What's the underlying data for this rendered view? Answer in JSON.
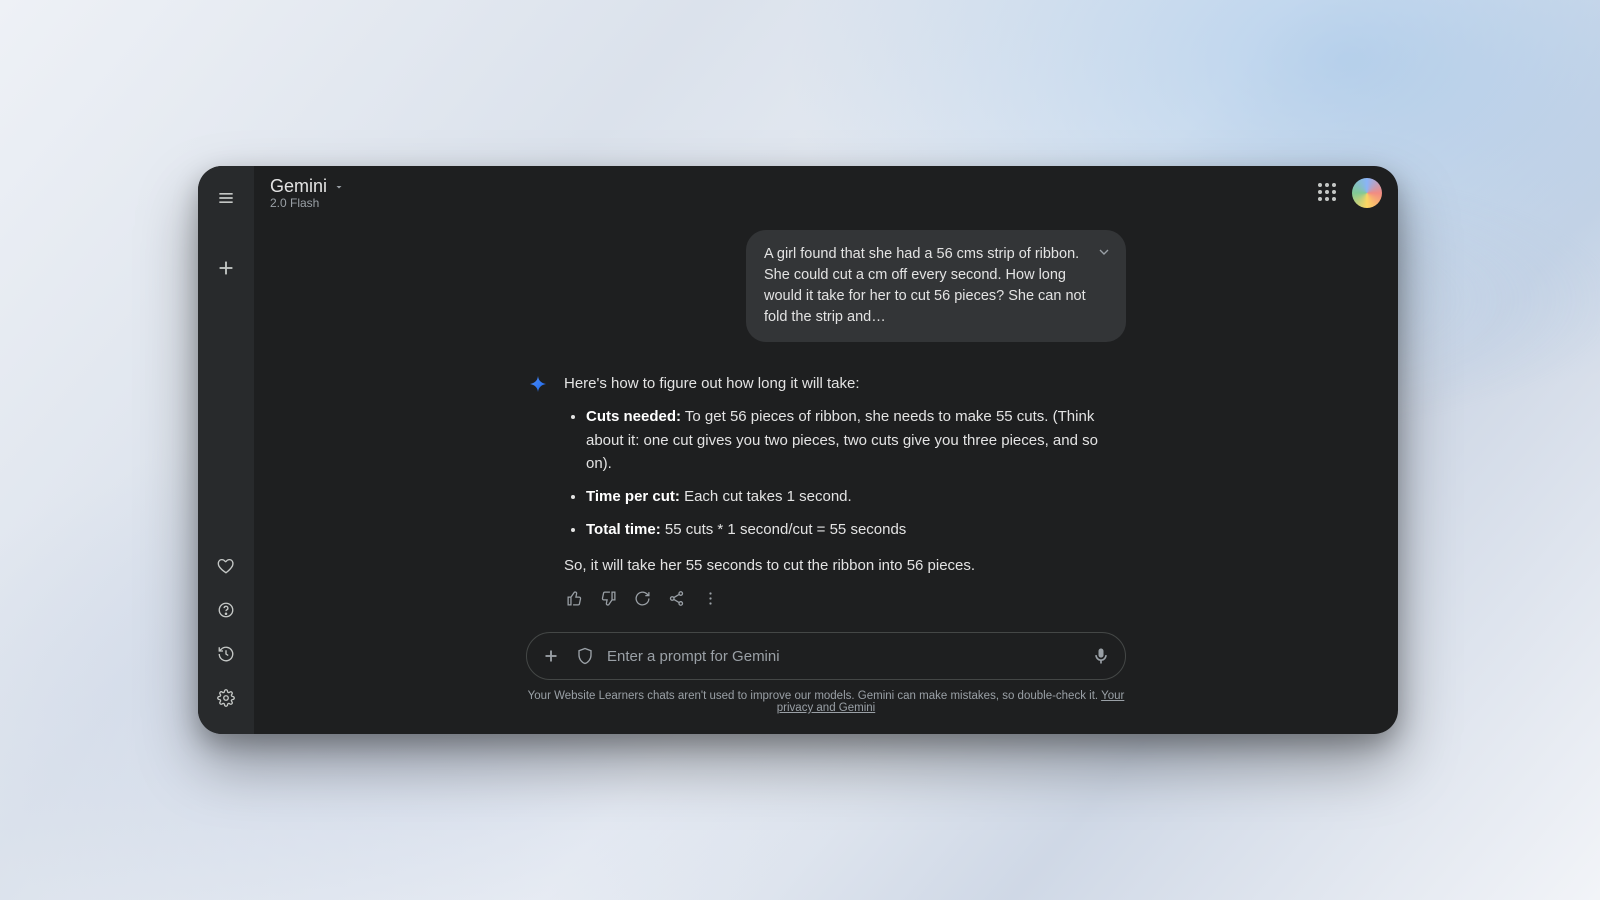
{
  "header": {
    "title": "Gemini",
    "subtitle": "2.0 Flash"
  },
  "user_message": {
    "text": "A girl found that she had a 56 cms strip of ribbon. She could cut a cm off every second. How long would it take for her to cut 56 pieces? She can not fold the strip and…"
  },
  "assistant_message": {
    "intro": "Here's how to figure out how long it will take:",
    "bullets": [
      {
        "label": "Cuts needed:",
        "text": " To get 56 pieces of ribbon, she needs to make 55 cuts. (Think about it: one cut gives you two pieces, two cuts give you three pieces, and so on)."
      },
      {
        "label": "Time per cut:",
        "text": " Each cut takes 1 second."
      },
      {
        "label": "Total time:",
        "text": " 55 cuts * 1 second/cut = 55 seconds"
      }
    ],
    "conclusion": "So, it will take her 55 seconds to cut the ribbon into 56 pieces."
  },
  "input": {
    "placeholder": "Enter a prompt for Gemini"
  },
  "disclaimer": {
    "text": "Your Website Learners chats aren't used to improve our models. Gemini can make mistakes, so double-check it. ",
    "link": "Your privacy and Gemini"
  }
}
